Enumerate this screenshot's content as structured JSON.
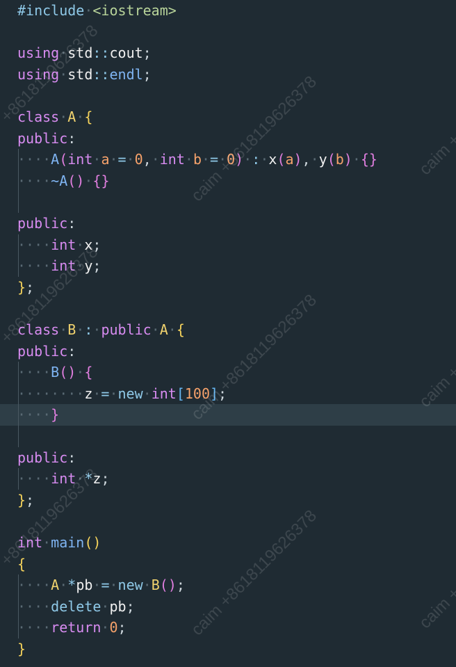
{
  "editor": {
    "active_line": 19,
    "lines": [
      [
        [
          "#include",
          "op"
        ],
        [
          "·",
          "ws"
        ],
        [
          "<iostream>",
          "str"
        ]
      ],
      [],
      [
        [
          "using",
          "kw"
        ],
        [
          "·",
          "ws"
        ],
        [
          "std",
          "name"
        ],
        [
          "::",
          "op"
        ],
        [
          "cout",
          "name"
        ],
        [
          ";",
          "punc"
        ]
      ],
      [
        [
          "using",
          "kw"
        ],
        [
          "·",
          "ws"
        ],
        [
          "std",
          "name"
        ],
        [
          "::",
          "op"
        ],
        [
          "endl",
          "fn"
        ],
        [
          ";",
          "punc"
        ]
      ],
      [],
      [
        [
          "class",
          "kw"
        ],
        [
          "·",
          "ws"
        ],
        [
          "A",
          "cls"
        ],
        [
          "·",
          "ws"
        ],
        [
          "{",
          "br1"
        ]
      ],
      [
        [
          "public",
          "kw"
        ],
        [
          ":",
          "punc"
        ]
      ],
      [
        [
          "····",
          "ws"
        ],
        [
          "A",
          "fn"
        ],
        [
          "(",
          "br2"
        ],
        [
          "int",
          "kw"
        ],
        [
          "·",
          "ws"
        ],
        [
          "a",
          "type"
        ],
        [
          "·",
          "ws"
        ],
        [
          "=",
          "op"
        ],
        [
          "·",
          "ws"
        ],
        [
          "0",
          "num"
        ],
        [
          ",",
          "punc"
        ],
        [
          "·",
          "ws"
        ],
        [
          "int",
          "kw"
        ],
        [
          "·",
          "ws"
        ],
        [
          "b",
          "type"
        ],
        [
          "·",
          "ws"
        ],
        [
          "=",
          "op"
        ],
        [
          "·",
          "ws"
        ],
        [
          "0",
          "num"
        ],
        [
          ")",
          "br2"
        ],
        [
          "·",
          "ws"
        ],
        [
          ":",
          "op"
        ],
        [
          "·",
          "ws"
        ],
        [
          "x",
          "name"
        ],
        [
          "(",
          "br2"
        ],
        [
          "a",
          "type"
        ],
        [
          ")",
          "br2"
        ],
        [
          ",",
          "punc"
        ],
        [
          "·",
          "ws"
        ],
        [
          "y",
          "name"
        ],
        [
          "(",
          "br2"
        ],
        [
          "b",
          "type"
        ],
        [
          ")",
          "br2"
        ],
        [
          "·",
          "ws"
        ],
        [
          "{}",
          "br2"
        ]
      ],
      [
        [
          "····",
          "ws"
        ],
        [
          "~A",
          "fn"
        ],
        [
          "(",
          "br2"
        ],
        [
          ")",
          "br2"
        ],
        [
          "·",
          "ws"
        ],
        [
          "{}",
          "br2"
        ]
      ],
      [],
      [
        [
          "public",
          "kw"
        ],
        [
          ":",
          "punc"
        ]
      ],
      [
        [
          "····",
          "ws"
        ],
        [
          "int",
          "kw"
        ],
        [
          "·",
          "ws"
        ],
        [
          "x",
          "name"
        ],
        [
          ";",
          "punc"
        ]
      ],
      [
        [
          "····",
          "ws"
        ],
        [
          "int",
          "kw"
        ],
        [
          "·",
          "ws"
        ],
        [
          "y",
          "name"
        ],
        [
          ";",
          "punc"
        ]
      ],
      [
        [
          "}",
          "br1"
        ],
        [
          ";",
          "punc"
        ]
      ],
      [],
      [
        [
          "class",
          "kw"
        ],
        [
          "·",
          "ws"
        ],
        [
          "B",
          "cls"
        ],
        [
          "·",
          "ws"
        ],
        [
          ":",
          "op"
        ],
        [
          "·",
          "ws"
        ],
        [
          "public",
          "kw"
        ],
        [
          "·",
          "ws"
        ],
        [
          "A",
          "cls"
        ],
        [
          "·",
          "ws"
        ],
        [
          "{",
          "br1"
        ]
      ],
      [
        [
          "public",
          "kw"
        ],
        [
          ":",
          "punc"
        ]
      ],
      [
        [
          "····",
          "ws"
        ],
        [
          "B",
          "fn"
        ],
        [
          "(",
          "br2"
        ],
        [
          ")",
          "br2"
        ],
        [
          "·",
          "ws"
        ],
        [
          "{",
          "br2"
        ]
      ],
      [
        [
          "········",
          "ws"
        ],
        [
          "z",
          "name"
        ],
        [
          "·",
          "ws"
        ],
        [
          "=",
          "op"
        ],
        [
          "·",
          "ws"
        ],
        [
          "new",
          "op"
        ],
        [
          "·",
          "ws"
        ],
        [
          "int",
          "kw"
        ],
        [
          "[",
          "br3"
        ],
        [
          "100",
          "num"
        ],
        [
          "]",
          "br3"
        ],
        [
          ";",
          "punc"
        ]
      ],
      [
        [
          "····",
          "ws"
        ],
        [
          "}",
          "br2"
        ]
      ],
      [],
      [
        [
          "public",
          "kw"
        ],
        [
          ":",
          "punc"
        ]
      ],
      [
        [
          "····",
          "ws"
        ],
        [
          "int",
          "kw"
        ],
        [
          "·",
          "ws"
        ],
        [
          "*",
          "op"
        ],
        [
          "z",
          "name"
        ],
        [
          ";",
          "punc"
        ]
      ],
      [
        [
          "}",
          "br1"
        ],
        [
          ";",
          "punc"
        ]
      ],
      [],
      [
        [
          "int",
          "kw"
        ],
        [
          "·",
          "ws"
        ],
        [
          "main",
          "fn"
        ],
        [
          "(",
          "br1"
        ],
        [
          ")",
          "br1"
        ]
      ],
      [
        [
          "{",
          "br1"
        ]
      ],
      [
        [
          "····",
          "ws"
        ],
        [
          "A",
          "cls"
        ],
        [
          "·",
          "ws"
        ],
        [
          "*",
          "op"
        ],
        [
          "pb",
          "name"
        ],
        [
          "·",
          "ws"
        ],
        [
          "=",
          "op"
        ],
        [
          "·",
          "ws"
        ],
        [
          "new",
          "op"
        ],
        [
          "·",
          "ws"
        ],
        [
          "B",
          "cls"
        ],
        [
          "(",
          "br2"
        ],
        [
          ")",
          "br2"
        ],
        [
          ";",
          "punc"
        ]
      ],
      [
        [
          "····",
          "ws"
        ],
        [
          "delete",
          "op"
        ],
        [
          "·",
          "ws"
        ],
        [
          "pb",
          "name"
        ],
        [
          ";",
          "punc"
        ]
      ],
      [
        [
          "····",
          "ws"
        ],
        [
          "return",
          "kw"
        ],
        [
          "·",
          "ws"
        ],
        [
          "0",
          "num"
        ],
        [
          ";",
          "punc"
        ]
      ],
      [
        [
          "}",
          "br1"
        ]
      ]
    ],
    "guide_lines": [
      7,
      8,
      9,
      11,
      12,
      17,
      18,
      19,
      20,
      22,
      27,
      28,
      29
    ]
  },
  "watermark": {
    "texts": [
      "+8618119626378",
      "caim +8618119626378",
      "caim +8618119626378",
      "caim +"
    ]
  }
}
